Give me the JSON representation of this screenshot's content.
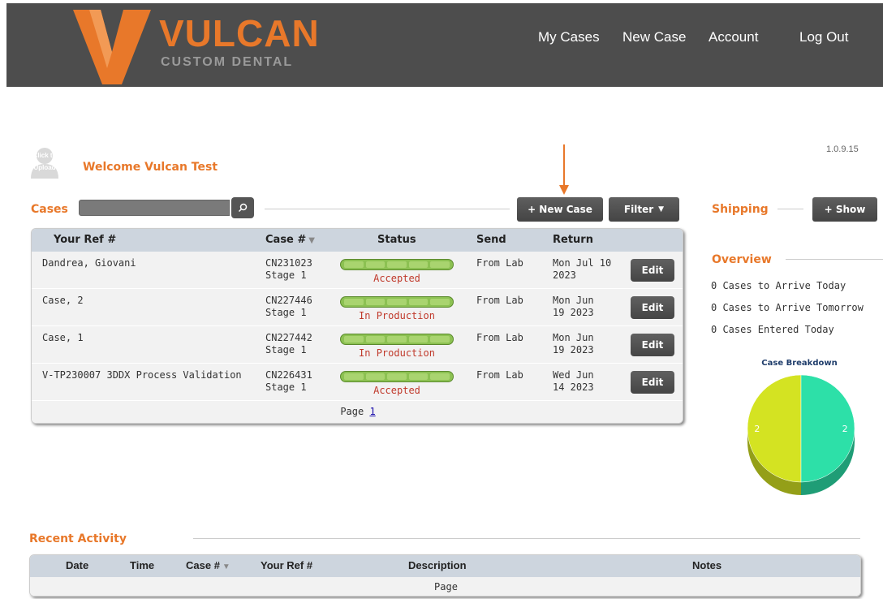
{
  "header": {
    "logo_word": "VULCAN",
    "logo_sub": "CUSTOM DENTAL",
    "nav": [
      "My Cases",
      "New Case",
      "Account",
      "Log Out"
    ]
  },
  "version": "1.0.9.15",
  "profile": {
    "avatar_text": "Click to Upload",
    "welcome": "Welcome Vulcan Test"
  },
  "cases": {
    "title": "Cases",
    "search_value": "",
    "new_case_label": "+ New Case",
    "filter_label": "Filter",
    "columns": [
      "Your Ref #",
      "Case #",
      "Status",
      "Send",
      "Return"
    ],
    "rows": [
      {
        "ref": "Dandrea, Giovani",
        "case_no": "CN231023",
        "stage": "Stage 1",
        "status": "Accepted",
        "send": "From Lab",
        "return_1": "Mon Jul 10",
        "return_2": "2023",
        "edit": "Edit"
      },
      {
        "ref": "Case, 2",
        "case_no": "CN227446",
        "stage": "Stage 1",
        "status": "In Production",
        "send": "From Lab",
        "return_1": "Mon Jun",
        "return_2": "19 2023",
        "edit": "Edit"
      },
      {
        "ref": "Case, 1",
        "case_no": "CN227442",
        "stage": "Stage 1",
        "status": "In Production",
        "send": "From Lab",
        "return_1": "Mon Jun",
        "return_2": "19 2023",
        "edit": "Edit"
      },
      {
        "ref": "V-TP230007 3DDX Process Validation",
        "case_no": "CN226431",
        "stage": "Stage 1",
        "status": "Accepted",
        "send": "From Lab",
        "return_1": "Wed Jun",
        "return_2": "14 2023",
        "edit": "Edit"
      }
    ],
    "page_label": "Page",
    "page_number": "1"
  },
  "shipping": {
    "title": "Shipping",
    "show_label": "+ Show"
  },
  "overview": {
    "title": "Overview",
    "items": [
      "0 Cases to Arrive Today",
      "0 Cases to Arrive Tomorrow",
      "0 Cases Entered Today"
    ]
  },
  "chart_data": {
    "type": "pie",
    "title": "Case Breakdown",
    "categories": [
      "",
      ""
    ],
    "values": [
      2,
      2
    ],
    "colors": [
      "#d4e322",
      "#2de0a8"
    ]
  },
  "recent_activity": {
    "title": "Recent Activity",
    "columns": [
      "Date",
      "Time",
      "Case #",
      "Your Ref #",
      "Description",
      "Notes"
    ],
    "page_label": "Page"
  }
}
